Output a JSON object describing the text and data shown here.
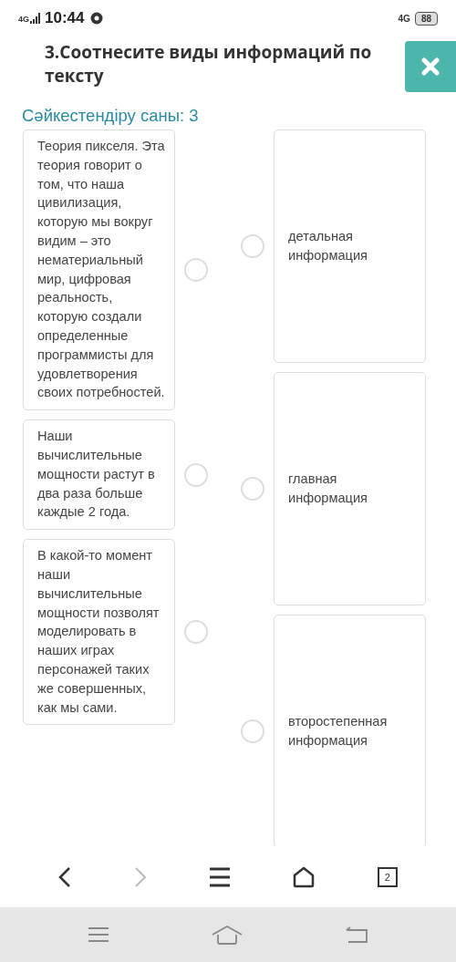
{
  "status_bar": {
    "signal_label": "4G",
    "time": "10:44",
    "network": "4G",
    "battery": "88"
  },
  "question": {
    "title": "3.Соотнесите виды информаций по тексту",
    "count_label": "Сәйкестендіру саны: 3"
  },
  "left_items": [
    {
      "text": "Теория пикселя. Эта теория говорит о том, что наша цивилизация, которую мы вокруг видим – это нематериальный мир, цифровая реальность, которую создали определенные программисты для удовлетворения своих потребностей."
    },
    {
      "text": "Наши вычислительные мощности растут в два раза больше каждые 2 года."
    },
    {
      "text": "В какой-то момент наши вычислительные мощности позволят моделировать в наших играх персонажей таких же совершенных, как мы сами."
    }
  ],
  "right_items": [
    {
      "text": "детальная информация"
    },
    {
      "text": "главная информация"
    },
    {
      "text": "второстепенная информация"
    }
  ],
  "browser_bar": {
    "forward_disabled": true,
    "tab_count": "2"
  }
}
